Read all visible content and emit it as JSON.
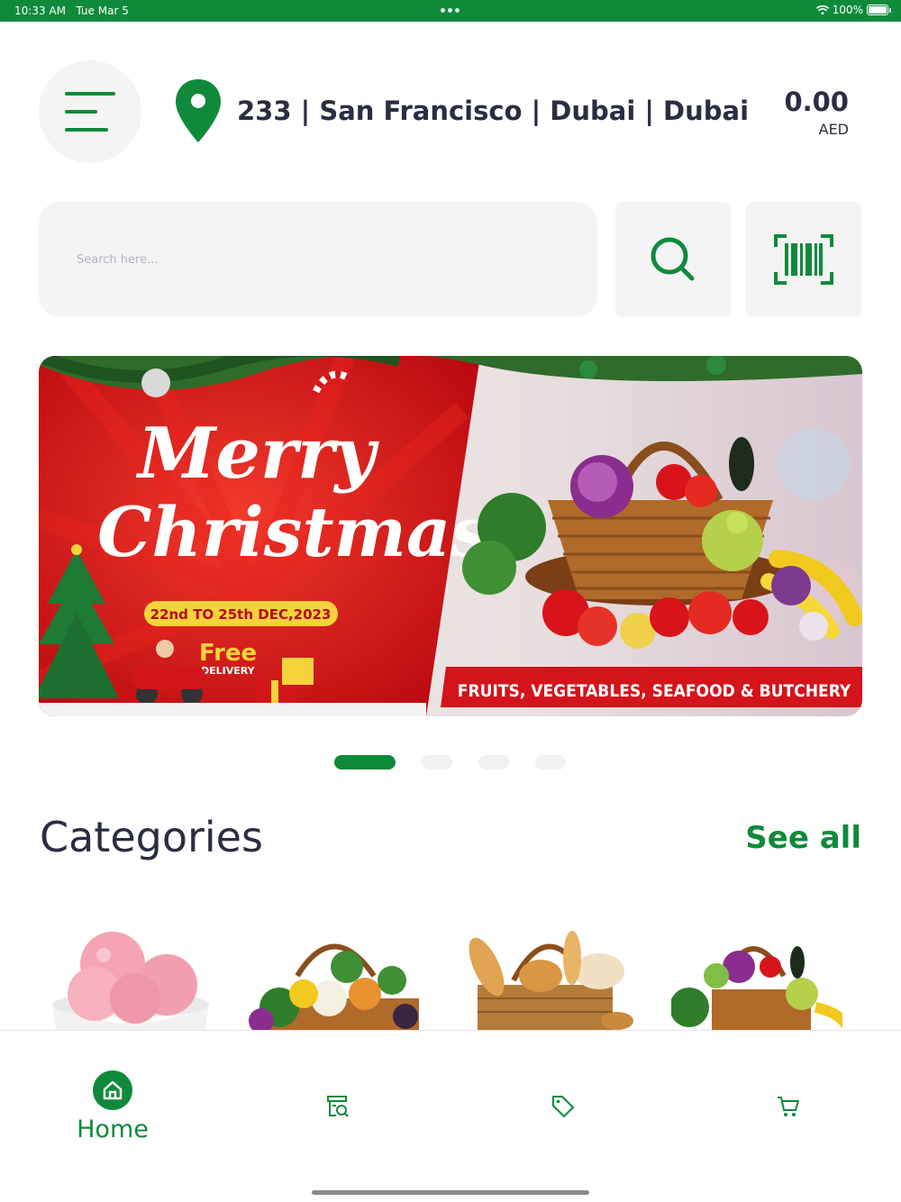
{
  "status_bar": {
    "time": "10:33 AM",
    "date": "Tue Mar 5",
    "battery": "100%"
  },
  "header": {
    "location": "233 | San Francisco | Dubai | Dubai",
    "balance_amount": "0.00",
    "balance_currency": "AED"
  },
  "search": {
    "placeholder": "Search here..."
  },
  "banner": {
    "left_title_line1": "Merry",
    "left_title_line2": "Christmas",
    "dates": "22nd TO 25th DEC,2023",
    "delivery_line1": "Free",
    "delivery_line2": "DELIVERY",
    "right_caption": "FRUITS, VEGETABLES, SEAFOOD & BUTCHERY",
    "slides_total": 4,
    "active_slide": 1
  },
  "categories": {
    "title": "Categories",
    "see_all": "See all",
    "items": [
      "ice-cream",
      "vegetables-basket",
      "bakery-basket",
      "fruits-basket"
    ]
  },
  "tabbar": {
    "home_label": "Home",
    "tabs": [
      "home",
      "search-catalog",
      "offers",
      "cart"
    ]
  },
  "colors": {
    "brand_green": "#0f8a3b",
    "text_dark": "#2b2d42",
    "banner_red": "#d3141b"
  }
}
